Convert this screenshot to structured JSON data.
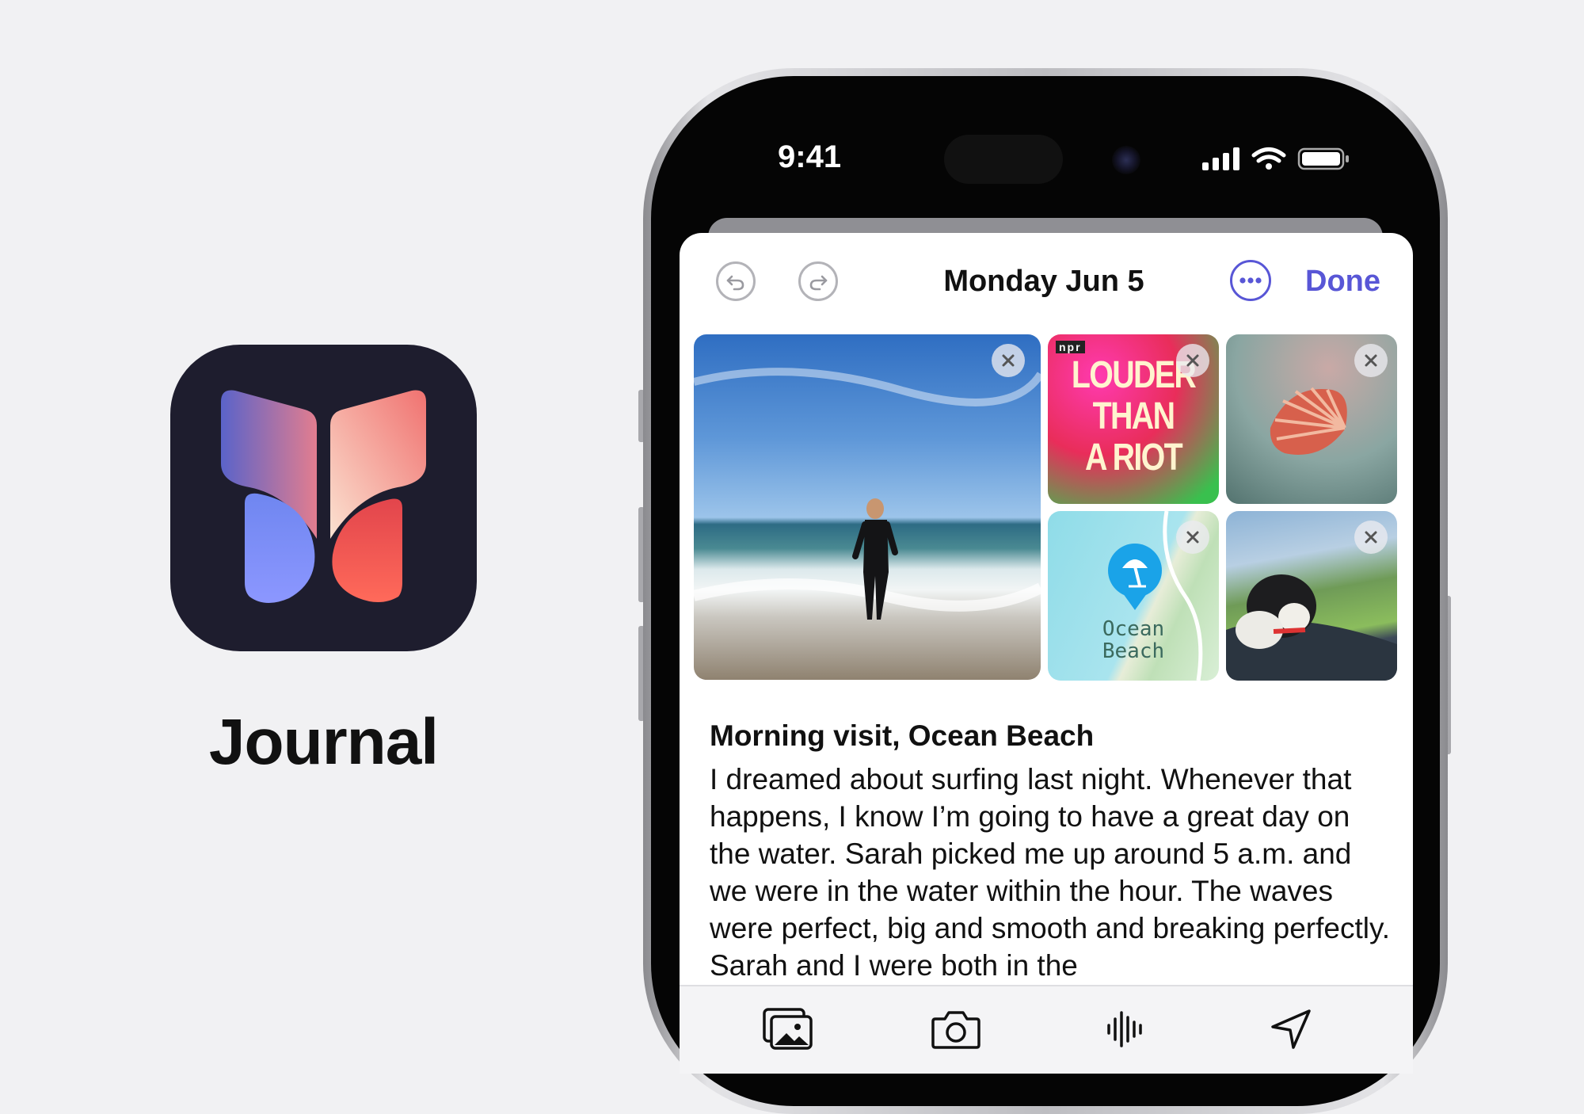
{
  "app": {
    "name": "Journal"
  },
  "status_bar": {
    "time": "9:41"
  },
  "header": {
    "date": "Monday Jun 5",
    "done_label": "Done"
  },
  "attachments": {
    "podcast": {
      "logo": "npr",
      "title_line1": "LOUDER",
      "title_line2": "THAN",
      "title_line3": "A RIOT"
    },
    "map": {
      "place_line1": "Ocean",
      "place_line2": "Beach"
    }
  },
  "entry": {
    "title": "Morning visit, Ocean Beach",
    "body": "I dreamed about surfing last night. Whenever that happens, I know I’m going to have a great day on the water. Sarah picked me up around 5 a.m. and we were in the water within the hour. The waves were perfect, big and smooth and breaking perfectly. Sarah and I were both in the"
  },
  "toolbar": {
    "items": [
      "photo-library-icon",
      "camera-icon",
      "audio-waveform-icon",
      "location-arrow-icon"
    ]
  },
  "colors": {
    "accent": "#5856d6",
    "background": "#f1f1f3",
    "icon_bg": "#1e1d2e"
  }
}
